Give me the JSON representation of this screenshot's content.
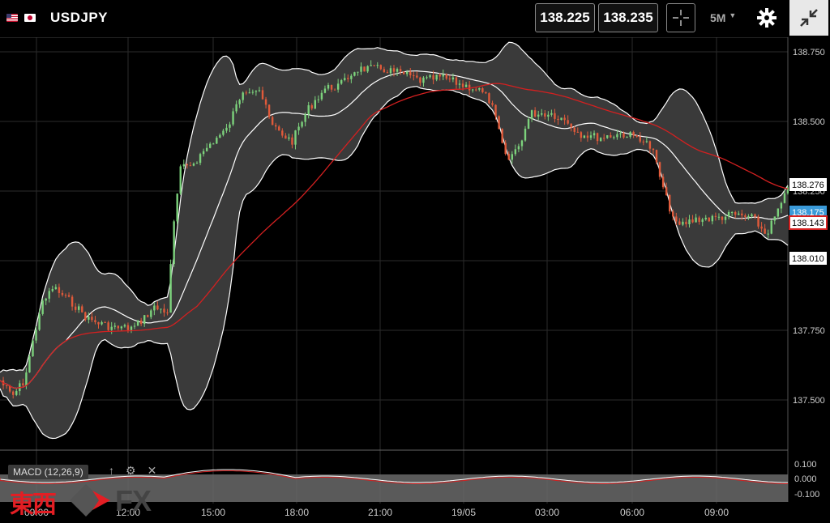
{
  "header": {
    "symbol": "USDJPY",
    "bid": "138.225",
    "ask": "138.235",
    "timeframe": "5M",
    "icons": [
      "us-flag-icon",
      "jp-flag-icon",
      "crosshair-icon",
      "chevron-down-icon",
      "gear-icon",
      "collapse-icon"
    ]
  },
  "price_axis": {
    "ticks": [
      "138.750",
      "138.500",
      "138.250",
      "137.750",
      "137.500"
    ],
    "labels": {
      "upper_band": "138.276",
      "last_price": "138.175",
      "ma": "138.143",
      "lower_band": "138.010"
    }
  },
  "macd": {
    "label": "MACD (12,26,9)",
    "ticks": [
      "0.100",
      "0.000",
      "-0.100"
    ],
    "icons": [
      "arrow-up-icon",
      "gear-icon",
      "close-icon"
    ]
  },
  "time_axis": {
    "ticks": [
      "09:00",
      "12:00",
      "15:00",
      "18:00",
      "21:00",
      "19/05",
      "03:00",
      "06:00",
      "09:00"
    ]
  },
  "logo": {
    "kanji": "東西",
    "fx": "FX"
  },
  "colors": {
    "up": "#7cd27c",
    "down": "#e05a3a",
    "band_fill": "#3a3a3a",
    "band_line": "#ffffff",
    "ma_line": "#d42020",
    "last_price_bg": "#3a9ad9",
    "ma_label_border": "#d42020"
  },
  "chart_data": {
    "type": "candlestick",
    "x_range": [
      "09:00",
      "09:00 next day"
    ],
    "ylim": [
      137.4,
      138.78
    ],
    "series": [
      {
        "name": "Bollinger upper",
        "x": [
          "09:00",
          "12:00",
          "15:00",
          "18:00",
          "21:00",
          "19/05",
          "03:00",
          "06:00",
          "09:00"
        ],
        "values": [
          137.7,
          137.95,
          138.55,
          138.7,
          138.72,
          138.72,
          138.55,
          138.45,
          138.26
        ]
      },
      {
        "name": "Bollinger middle",
        "x": [
          "09:00",
          "12:00",
          "15:00",
          "18:00",
          "21:00",
          "19/05",
          "03:00",
          "06:00",
          "09:00"
        ],
        "values": [
          137.55,
          137.8,
          138.1,
          138.58,
          138.68,
          138.62,
          138.4,
          138.35,
          138.17
        ]
      },
      {
        "name": "Bollinger lower",
        "x": [
          "09:00",
          "12:00",
          "15:00",
          "18:00",
          "21:00",
          "19/05",
          "03:00",
          "06:00",
          "09:00"
        ],
        "values": [
          137.45,
          137.7,
          137.8,
          138.4,
          138.62,
          138.5,
          138.25,
          138.3,
          138.01
        ]
      },
      {
        "name": "Moving average",
        "x": [
          "09:00",
          "12:00",
          "15:00",
          "18:00",
          "21:00",
          "19/05",
          "03:00",
          "06:00",
          "09:00"
        ],
        "values": [
          137.52,
          137.72,
          137.85,
          138.45,
          138.65,
          138.68,
          138.52,
          138.42,
          138.14
        ]
      }
    ]
  }
}
